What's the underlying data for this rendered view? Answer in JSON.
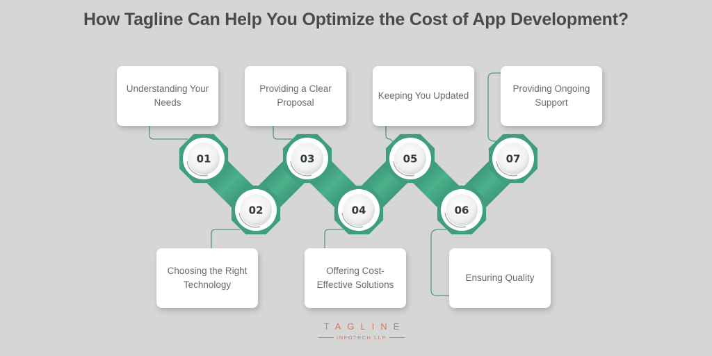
{
  "title": "How Tagline Can Help You Optimize the Cost of App Development?",
  "steps": [
    {
      "number": "01",
      "label": "Understanding Your Needs"
    },
    {
      "number": "02",
      "label": "Choosing the Right Technology"
    },
    {
      "number": "03",
      "label": "Providing a Clear Proposal"
    },
    {
      "number": "04",
      "label": "Offering Cost-Effective Solutions"
    },
    {
      "number": "05",
      "label": "Keeping You Updated"
    },
    {
      "number": "06",
      "label": "Ensuring Quality"
    },
    {
      "number": "07",
      "label": "Providing Ongoing Support"
    }
  ],
  "colors": {
    "accent": "#3f9e7c",
    "accent_dark": "#2e7d62",
    "accent_light": "#5bbf98",
    "background": "#d6d6d6",
    "logo": "#e0735a"
  },
  "logo": {
    "brand": "TAGLINE",
    "sub": "INFOTECH LLP"
  }
}
